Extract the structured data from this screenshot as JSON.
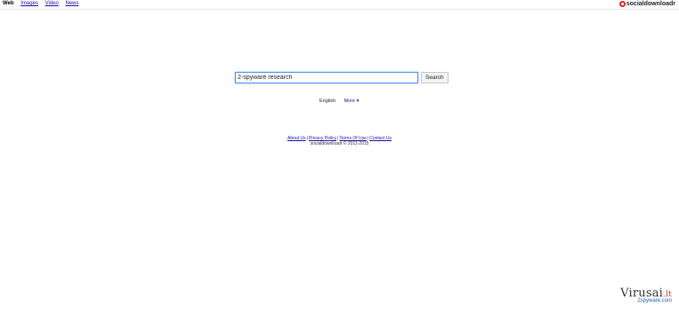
{
  "nav": {
    "items": [
      {
        "label": "Web",
        "active": true
      },
      {
        "label": "Images",
        "active": false
      },
      {
        "label": "Video",
        "active": false
      },
      {
        "label": "News",
        "active": false
      }
    ]
  },
  "brand": {
    "name": "socialdownloadr",
    "logo_color": "#e0242b"
  },
  "search": {
    "value": "2-spyware research",
    "button_label": "Search"
  },
  "language": {
    "current": "English",
    "more_label": "More ▾"
  },
  "footer": {
    "links": [
      "About Us",
      "Privacy Policy",
      "Terms Of Use",
      "Contact Us"
    ],
    "separator": "|",
    "copyright": "socialdownloadr © 2011-2015"
  },
  "watermark": {
    "main": "Virusai",
    "tld": ".lt",
    "sub": "2spyware.com"
  }
}
